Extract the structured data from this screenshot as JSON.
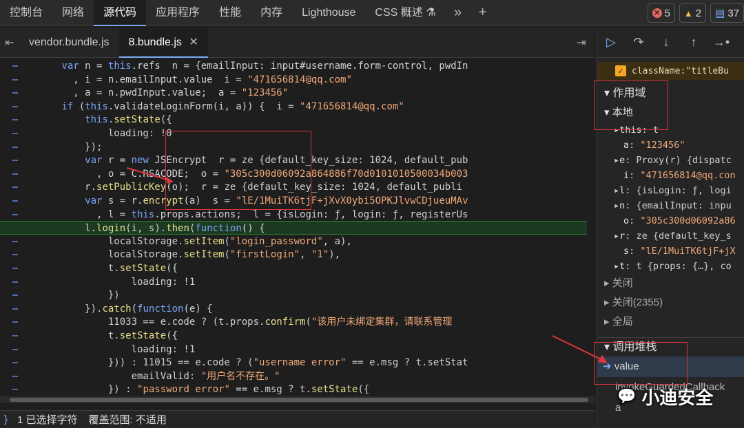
{
  "top_tabs": [
    "控制台",
    "网络",
    "源代码",
    "应用程序",
    "性能",
    "内存",
    "Lighthouse",
    "CSS 概述"
  ],
  "css_overview_icon": "flask-icon",
  "badges": {
    "errors": "5",
    "warnings": "2",
    "messages": "37"
  },
  "file_tabs": [
    "vendor.bundle.js",
    "8.bundle.js"
  ],
  "code": [
    "        var n = this.refs  n = {emailInput: input#username.form-control, pwdIn",
    "          , i = n.emailInput.value  i = \"471656814@qq.com\"",
    "          , a = n.pwdInput.value;  a = \"123456\"",
    "        if (this.validateLoginForm(i, a)) {  i = \"471656814@qq.com\"",
    "            this.setState({",
    "                loading: !0",
    "            });",
    "            var r = new JSEncrypt  r = ze {default_key_size: 1024, default_pub",
    "              , o = C.RSACODE;  o = \"305c300d06092a864886f70d0101010500034b003",
    "            r.setPublicKey(o);  r = ze {default_key_size: 1024, default_publi",
    "            var s = r.encrypt(a)  s = \"lE/1MuiTK6tjF+jXvX0ybi5OPKJlvwCDjueuMAv",
    "              , l = this.props.actions;  l = {isLogin: ƒ, login: ƒ, registerUs",
    "            l.login(i, s).then(function() {",
    "                localStorage.setItem(\"login_password\", a),",
    "                localStorage.setItem(\"firstLogin\", \"1\"),",
    "                t.setState({",
    "                    loading: !1",
    "                })",
    "            }).catch(function(e) {",
    "                11033 == e.code ? (t.props.confirm(\"该用户未绑定集群，请联系管理",
    "                t.setState({",
    "                    loading: !1",
    "                })) : 11015 == e.code ? (\"username error\" == e.msg ? t.setStat",
    "                    emailValid: \"用户名不存在。\"",
    "                }) : \"password error\" == e.msg ? t.setState({"
  ],
  "statusbar": {
    "selected": "1 已选择字符",
    "coverage": "覆盖范围: 不适用"
  },
  "right": {
    "condition": "className:\"titleBu",
    "scope_title": "作用域",
    "local_title": "本地",
    "scope_vars": [
      {
        "name": "this",
        "value": "t",
        "expand": true
      },
      {
        "name": "a",
        "value": "\"123456\"",
        "expand": false
      },
      {
        "name": "e",
        "value": "Proxy(r) {dispatc",
        "expand": true
      },
      {
        "name": "i",
        "value": "\"471656814@qq.con",
        "expand": false
      },
      {
        "name": "l",
        "value": "{isLogin: ƒ, logi",
        "expand": true
      },
      {
        "name": "n",
        "value": "{emailInput: inpu",
        "expand": true
      },
      {
        "name": "o",
        "value": "\"305c300d06092a86",
        "expand": false
      },
      {
        "name": "r",
        "value": "ze {default_key_s",
        "expand": true
      },
      {
        "name": "s",
        "value": "\"lE/1MuiTK6tjF+jX",
        "expand": false
      },
      {
        "name": "t",
        "value": "t {props: {…}, co",
        "expand": true
      }
    ],
    "closure1": "关闭",
    "closure2": "关闭(2355)",
    "global": "全局",
    "callstack_title": "调用堆栈",
    "frames": [
      "value",
      "invokeGuardedCallback",
      "a"
    ]
  },
  "watermark": "小迪安全"
}
